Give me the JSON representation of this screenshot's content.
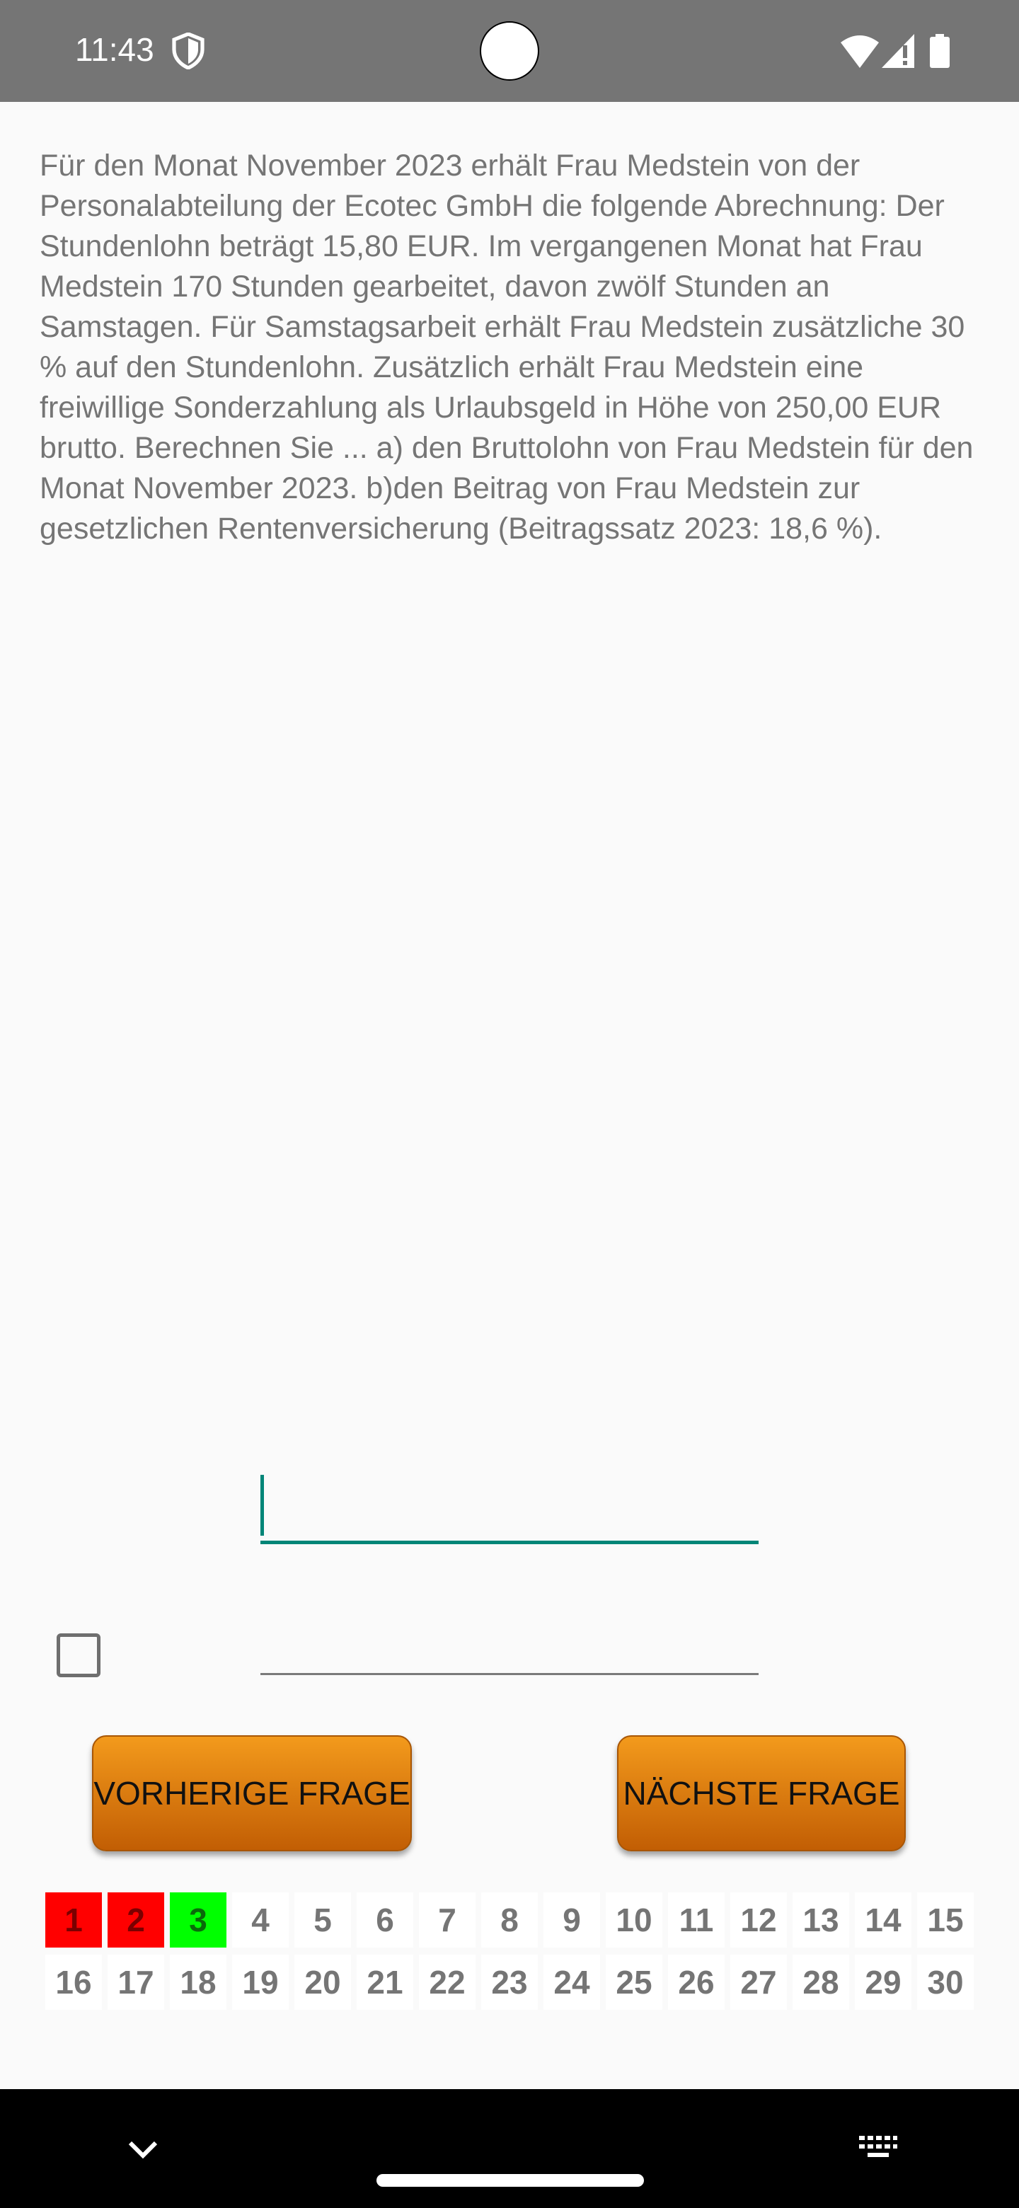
{
  "status_bar": {
    "time": "11:43",
    "icons": [
      "shield-icon",
      "wifi-icon",
      "signal-icon",
      "battery-icon"
    ]
  },
  "question": {
    "text": "Für den Monat November 2023 erhält Frau Medstein von der Personalabteilung der Ecotec GmbH die folgende Abrechnung: Der Stundenlohn beträgt 15,80 EUR. Im vergangenen Monat hat Frau Medstein 170 Stunden gearbeitet, davon zwölf Stunden an Samstagen. Für Samstagsarbeit erhält Frau Medstein zusätzliche 30 % auf den Stundenlohn. Zusätzlich erhält Frau Medstein eine freiwillige Sonderzahlung als Urlaubsgeld in Höhe von 250,00 EUR brutto. Berechnen Sie ... a) den Bruttolohn von Frau Medstein für den Monat November 2023. b)den Beitrag von Frau Medstein zur gesetzlichen Rentenversicherung (Beitragssatz 2023: 18,6 %)."
  },
  "answer": {
    "first_value": "",
    "second_value": "",
    "checkbox_checked": false
  },
  "buttons": {
    "previous": "VORHERIGE FRAGE",
    "next": "NÄCHSTE FRAGE"
  },
  "question_grid": {
    "colors": {
      "wrong": "#ff0000",
      "correct": "#00ff00",
      "default": "#ffffff"
    },
    "items": [
      {
        "label": "1",
        "status": "wrong"
      },
      {
        "label": "2",
        "status": "wrong"
      },
      {
        "label": "3",
        "status": "correct"
      },
      {
        "label": "4",
        "status": "none"
      },
      {
        "label": "5",
        "status": "none"
      },
      {
        "label": "6",
        "status": "none"
      },
      {
        "label": "7",
        "status": "none"
      },
      {
        "label": "8",
        "status": "none"
      },
      {
        "label": "9",
        "status": "none"
      },
      {
        "label": "10",
        "status": "none"
      },
      {
        "label": "11",
        "status": "none"
      },
      {
        "label": "12",
        "status": "none"
      },
      {
        "label": "13",
        "status": "none"
      },
      {
        "label": "14",
        "status": "none"
      },
      {
        "label": "15",
        "status": "none"
      },
      {
        "label": "16",
        "status": "none"
      },
      {
        "label": "17",
        "status": "none"
      },
      {
        "label": "18",
        "status": "none"
      },
      {
        "label": "19",
        "status": "none"
      },
      {
        "label": "20",
        "status": "none"
      },
      {
        "label": "21",
        "status": "none"
      },
      {
        "label": "22",
        "status": "none"
      },
      {
        "label": "23",
        "status": "none"
      },
      {
        "label": "24",
        "status": "none"
      },
      {
        "label": "25",
        "status": "none"
      },
      {
        "label": "26",
        "status": "none"
      },
      {
        "label": "27",
        "status": "none"
      },
      {
        "label": "28",
        "status": "none"
      },
      {
        "label": "29",
        "status": "none"
      },
      {
        "label": "30",
        "status": "none"
      }
    ]
  },
  "navigation_bar": {
    "icons": [
      "chevron-down-icon",
      "home-handle",
      "keyboard-icon"
    ]
  }
}
